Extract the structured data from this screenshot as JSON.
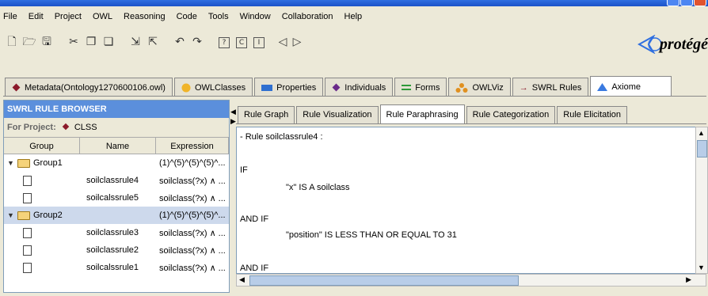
{
  "menu": [
    "File",
    "Edit",
    "Project",
    "OWL",
    "Reasoning",
    "Code",
    "Tools",
    "Window",
    "Collaboration",
    "Help"
  ],
  "logo": {
    "text": "protégé",
    "color": "#2f6fe0"
  },
  "main_tabs": [
    {
      "label": "Metadata(Ontology1270600106.owl)",
      "icon": "diamond-icon",
      "color": "#8b1a2b"
    },
    {
      "label": "OWLClasses",
      "icon": "class-circle-icon",
      "color": "#f0b429"
    },
    {
      "label": "Properties",
      "icon": "property-rect-icon",
      "color": "#2f6fd0"
    },
    {
      "label": "Individuals",
      "icon": "individual-diamond-icon",
      "color": "#6a2a8a"
    },
    {
      "label": "Forms",
      "icon": "form-lines-icon",
      "color": "#2f9a3a"
    },
    {
      "label": "OWLViz",
      "icon": "owlviz-icon",
      "color": "#e09020"
    },
    {
      "label": "SWRL Rules",
      "icon": "arrow-right-icon",
      "color": "#8b1a2b"
    },
    {
      "label": "Axiome",
      "icon": "triangle-icon",
      "color": "#3a7ae0",
      "active": true
    }
  ],
  "left_panel": {
    "title": "SWRL RULE BROWSER",
    "project_label": "For Project:",
    "project_value": "CLSS",
    "columns": [
      "Group",
      "Name",
      "Expression"
    ],
    "rows": [
      {
        "type": "group",
        "group": "Group1",
        "name": "",
        "expression": "(1)^(5)^(5)^(5)^...",
        "selected": false
      },
      {
        "type": "rule",
        "group": "",
        "name": "soilclassrule4",
        "expression": "soilclass(?x) ∧ ...",
        "selected": false
      },
      {
        "type": "rule",
        "group": "",
        "name": "soilcalssrule5",
        "expression": "soilclass(?x) ∧ ...",
        "selected": false
      },
      {
        "type": "group",
        "group": "Group2",
        "name": "",
        "expression": "(1)^(5)^(5)^(5)^...",
        "selected": true
      },
      {
        "type": "rule",
        "group": "",
        "name": "soilclassrule3",
        "expression": "soilclass(?x) ∧ ...",
        "selected": false
      },
      {
        "type": "rule",
        "group": "",
        "name": "soilclassrule2",
        "expression": "soilclass(?x) ∧ ...",
        "selected": false
      },
      {
        "type": "rule",
        "group": "",
        "name": "soilcalssrule1",
        "expression": "soilclass(?x) ∧ ...",
        "selected": false
      }
    ]
  },
  "sub_tabs": [
    {
      "label": "Rule Graph",
      "active": false
    },
    {
      "label": "Rule Visualization",
      "active": false
    },
    {
      "label": "Rule Paraphrasing",
      "active": true
    },
    {
      "label": "Rule Categorization",
      "active": false
    },
    {
      "label": "Rule Elicitation",
      "active": false
    }
  ],
  "content": {
    "lines": [
      "- Rule soilclassrule4 :",
      "IF",
      "\"x\" IS A soilclass",
      "AND IF",
      "\"position\" IS LESS THAN OR EQUAL TO 31",
      "AND IF"
    ]
  }
}
